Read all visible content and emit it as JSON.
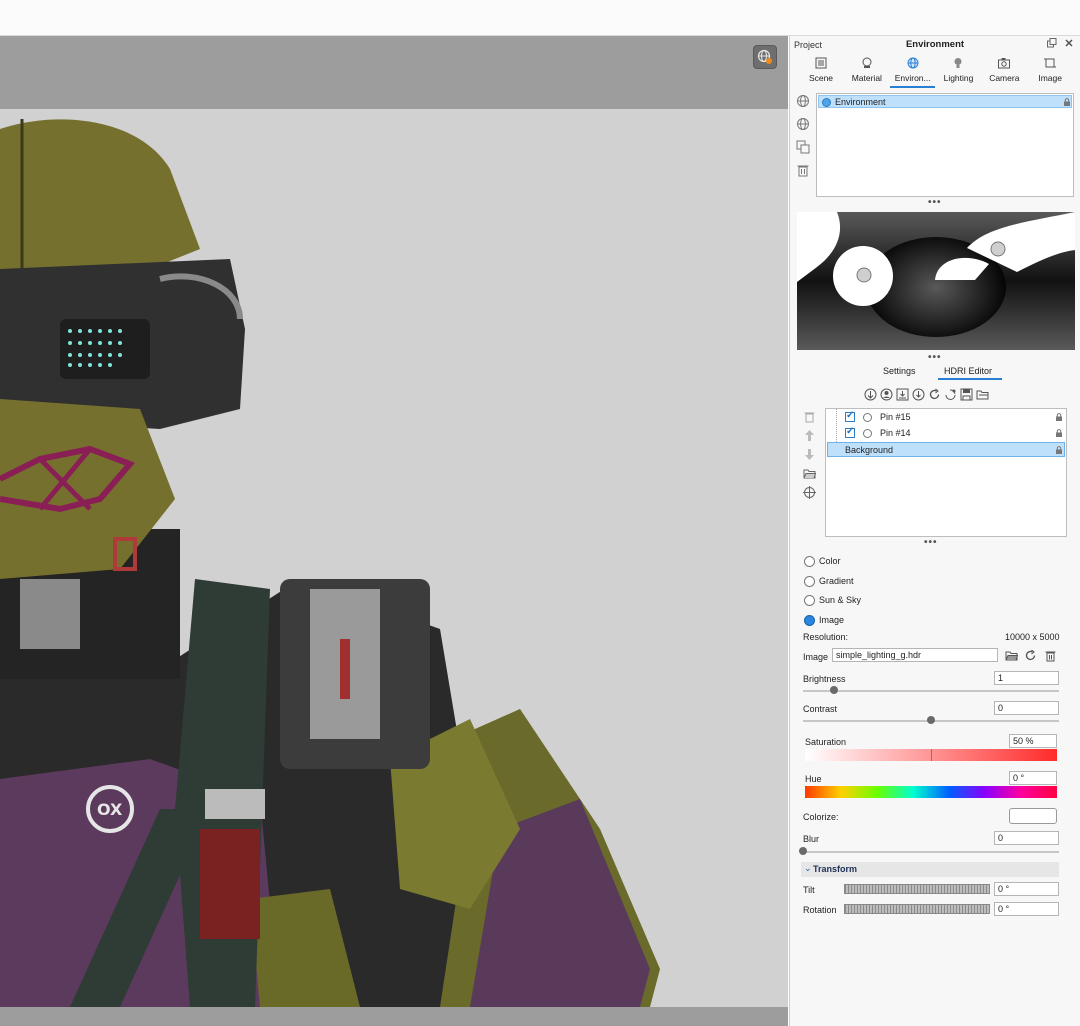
{
  "viewport": {
    "overlay_icon": "render-globe-icon"
  },
  "panel": {
    "project_label": "Project",
    "title": "Environment",
    "header_icons": [
      "float-window-icon",
      "close-icon"
    ]
  },
  "tabs": [
    {
      "label": "Scene",
      "icon": "scene-icon",
      "active": false
    },
    {
      "label": "Material",
      "icon": "material-sphere-icon",
      "active": false
    },
    {
      "label": "Environ...",
      "icon": "globe-icon",
      "active": true
    },
    {
      "label": "Lighting",
      "icon": "light-bulb-icon",
      "active": false
    },
    {
      "label": "Camera",
      "icon": "camera-icon",
      "active": false
    },
    {
      "label": "Image",
      "icon": "image-crop-icon",
      "active": false
    }
  ],
  "environment_list": {
    "items": [
      {
        "label": "Environment",
        "selected": true,
        "locked": true
      }
    ]
  },
  "env_side_icons": [
    "add-environment-icon",
    "globe-add-icon",
    "duplicate-icon",
    "trash-icon"
  ],
  "subtabs": [
    {
      "label": "Settings",
      "active": false
    },
    {
      "label": "HDRI Editor",
      "active": true
    }
  ],
  "hdri_tools": [
    "add-pin-icon",
    "add-area-pin-icon",
    "import-pin-icon",
    "export-pin-icon",
    "rotate-icon",
    "sync-icon",
    "save-icon",
    "folder-icon"
  ],
  "pin_side_icons": [
    "trash-icon",
    "arrow-up-icon",
    "arrow-down-icon",
    "folder-open-icon",
    "target-icon"
  ],
  "pins": [
    {
      "label": "Pin #15",
      "checked": true,
      "locked": true
    },
    {
      "label": "Pin #14",
      "checked": true,
      "locked": true
    },
    {
      "label": "Background",
      "selected": true,
      "locked": true
    }
  ],
  "background_modes": [
    {
      "label": "Color",
      "selected": false
    },
    {
      "label": "Gradient",
      "selected": false
    },
    {
      "label": "Sun & Sky",
      "selected": false
    },
    {
      "label": "Image",
      "selected": true
    }
  ],
  "properties": {
    "resolution_label": "Resolution:",
    "resolution_value": "10000 x 5000",
    "image_label": "Image",
    "image_value": "simple_lighting_g.hdr",
    "brightness_label": "Brightness",
    "brightness_value": "1",
    "brightness_level": 0.12,
    "contrast_label": "Contrast",
    "contrast_value": "0",
    "contrast_level": 0.5,
    "saturation_label": "Saturation",
    "saturation_value": "50 %",
    "saturation_level": 0.5,
    "hue_label": "Hue",
    "hue_value": "0 °",
    "colorize_label": "Colorize:",
    "blur_label": "Blur",
    "blur_value": "0",
    "blur_level": 0.0
  },
  "transform": {
    "header": "Transform",
    "tilt_label": "Tilt",
    "tilt_value": "0 °",
    "rotation_label": "Rotation",
    "rotation_value": "0 °"
  },
  "colors": {
    "accent": "#2a7fd4",
    "selection": "#bfe0fb",
    "viewport_bg": "#d1d1d1",
    "viewport_frame": "#9d9d9d"
  }
}
